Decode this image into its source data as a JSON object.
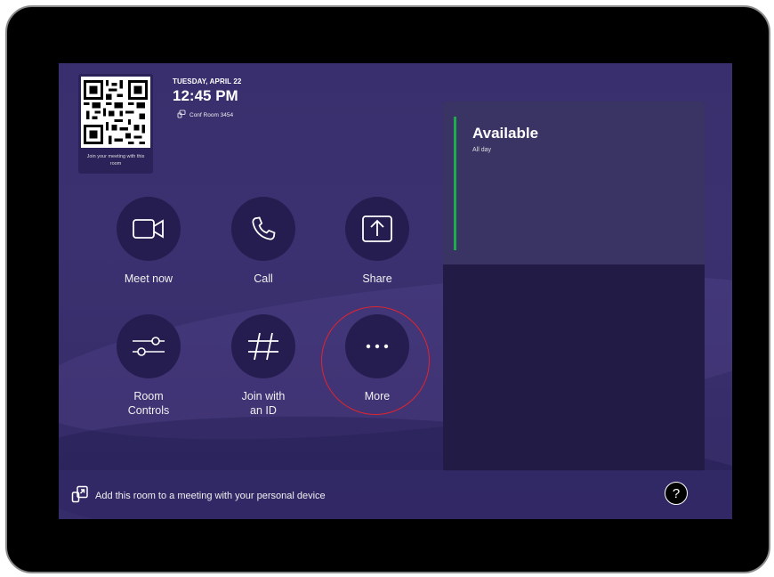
{
  "header": {
    "date": "TUESDAY, APRIL 22",
    "time": "12:45 PM",
    "room_name": "Conf Room 3454"
  },
  "qr": {
    "caption": "Join your meeting with this room",
    "icon": "qr-code-icon"
  },
  "actions": [
    {
      "label": "Meet now",
      "icon": "video-camera-icon"
    },
    {
      "label": "Call",
      "icon": "phone-icon"
    },
    {
      "label": "Share",
      "icon": "share-screen-icon"
    },
    {
      "label": "Room Controls",
      "icon": "sliders-icon"
    },
    {
      "label": "Join with an ID",
      "icon": "hash-icon"
    },
    {
      "label": "More",
      "icon": "more-dots-icon"
    }
  ],
  "calendar": {
    "status": "Available",
    "subtitle": "All day",
    "status_color": "#1faa4d"
  },
  "footer": {
    "text": "Add this room to a meeting with your personal device",
    "help_icon": "help-icon"
  },
  "colors": {
    "highlight": "#e0242e",
    "background": "#3a2f6e"
  }
}
